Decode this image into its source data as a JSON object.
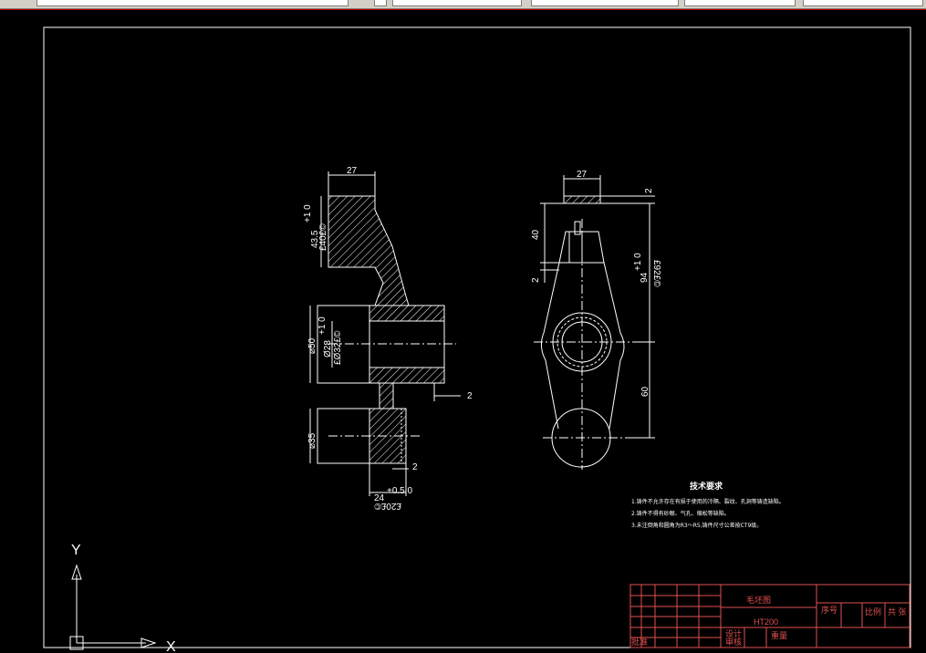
{
  "toolbar": {
    "controls": [
      "",
      "",
      "",
      "",
      "",
      ""
    ]
  },
  "dimensions": {
    "side": {
      "top_width": "27",
      "boss_height": "43.5",
      "boss_height_tol": "+1 0",
      "boss_ref": "£40£©",
      "hub_dia": "⌀50",
      "bore_dia": "Ø28",
      "bore_tol": "+1 0",
      "bore_ref": "£Ø32£©",
      "gap_right": "2",
      "lower_dia": "⌀35",
      "lower_gap": "2",
      "bottom_len": "24",
      "bottom_tol": "+0.5 0",
      "bottom_ref": "£20£©"
    },
    "front": {
      "top_width": "27",
      "top_gap": "2",
      "stem_height": "40",
      "stem_gap": "2",
      "total": "94",
      "total_tol": "+1 0",
      "total_ref": "£92£©",
      "lower_span": "60"
    }
  },
  "tech_requirements": {
    "title": "技术要求",
    "items": [
      "1.铸件不允许存在有损于使用的冷隔、裂纹、孔洞等铸造缺陷。",
      "2.铸件不得有砂眼、气孔、缩松等缺陷。",
      "3.未注倒角和圆角为R3～R5,铸件尺寸公差按CT9级。"
    ]
  },
  "title_block": {
    "drawing_name": "毛坯图",
    "material": "HT200",
    "seq_label": "序号",
    "scale_label": "比例",
    "sheet_label": "共 张",
    "designer_label": "设计",
    "checker_label": "审核",
    "approve_label": "批准",
    "weight_label": "重量"
  },
  "ucs": {
    "y_label": "Y",
    "x_label": "X"
  },
  "colors": {
    "background": "#000000",
    "lines": "#ffffff",
    "title_block": "#e05050",
    "frame": "#ffffff"
  }
}
